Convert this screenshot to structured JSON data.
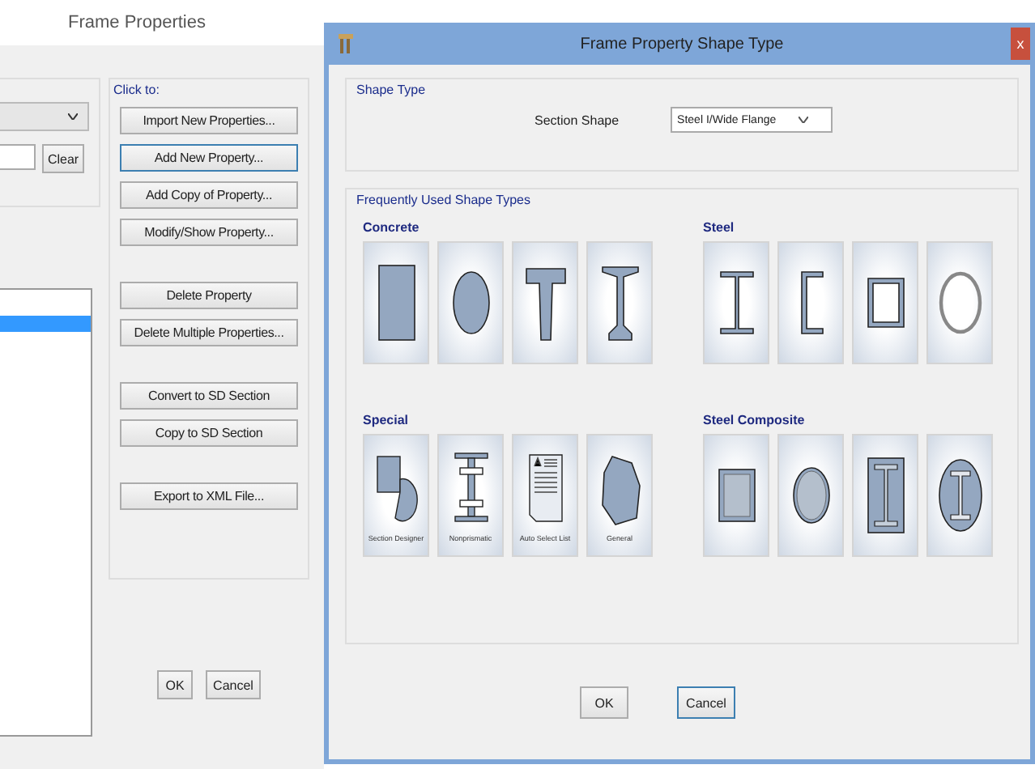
{
  "back_window": {
    "title": "Frame Properties",
    "clear_button": "Clear",
    "list": {
      "rows": [
        {
          "selected": false
        },
        {
          "selected": true
        }
      ]
    },
    "group_title": "Click to:",
    "buttons": [
      {
        "label": "Import New Properties...",
        "default": false,
        "gap": false
      },
      {
        "label": "Add New Property...",
        "default": true,
        "gap": false
      },
      {
        "label": "Add Copy of Property...",
        "default": false,
        "gap": false
      },
      {
        "label": "Modify/Show Property...",
        "default": false,
        "gap": false
      },
      {
        "label": "Delete Property",
        "default": false,
        "gap": true
      },
      {
        "label": "Delete Multiple Properties...",
        "default": false,
        "gap": false
      },
      {
        "label": "Convert to SD Section",
        "default": false,
        "gap": true
      },
      {
        "label": "Copy to SD Section",
        "default": false,
        "gap": false
      },
      {
        "label": "Export to XML File...",
        "default": false,
        "gap": true
      }
    ],
    "ok_button": "OK",
    "cancel_button": "Cancel"
  },
  "dialog": {
    "title": "Frame Property Shape Type",
    "close": "x",
    "shape_type_group": "Shape Type",
    "section_shape_label": "Section Shape",
    "section_shape_value": "Steel I/Wide Flange",
    "frequent_group": "Frequently Used Shape Types",
    "categories": [
      {
        "name": "Concrete",
        "tiles": [
          {
            "kind": "rect"
          },
          {
            "kind": "ellipse"
          },
          {
            "kind": "tee"
          },
          {
            "kind": "concrete-i"
          }
        ]
      },
      {
        "name": "Steel",
        "tiles": [
          {
            "kind": "steel-i"
          },
          {
            "kind": "channel"
          },
          {
            "kind": "box"
          },
          {
            "kind": "pipe"
          }
        ]
      },
      {
        "name": "Special",
        "tiles": [
          {
            "kind": "designer",
            "label": "Section Designer"
          },
          {
            "kind": "nonprismatic",
            "label": "Nonprismatic"
          },
          {
            "kind": "autoselect",
            "label": "Auto Select List"
          },
          {
            "kind": "general",
            "label": "General"
          }
        ]
      },
      {
        "name": "Steel Composite",
        "tiles": [
          {
            "kind": "filled-box"
          },
          {
            "kind": "filled-pipe"
          },
          {
            "kind": "encased-i"
          },
          {
            "kind": "filled-i"
          }
        ]
      }
    ],
    "ok_button": {
      "label": "OK",
      "default": false
    },
    "cancel_button": {
      "label": "Cancel",
      "default": true
    }
  }
}
